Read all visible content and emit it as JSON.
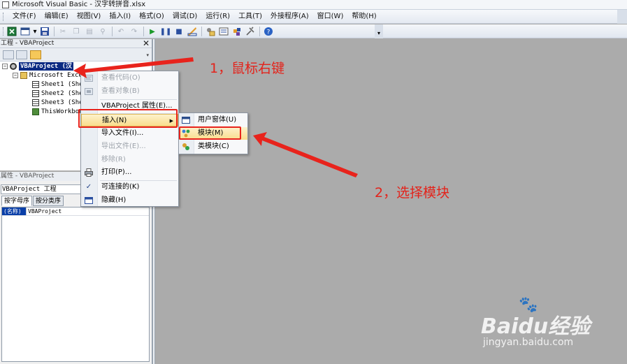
{
  "window": {
    "title": "Microsoft Visual Basic - 汉字转拼音.xlsx"
  },
  "menubar": {
    "items": [
      "文件(F)",
      "编辑(E)",
      "视图(V)",
      "插入(I)",
      "格式(O)",
      "调试(D)",
      "运行(R)",
      "工具(T)",
      "外接程序(A)",
      "窗口(W)",
      "帮助(H)"
    ]
  },
  "toolbar": {
    "icons": [
      "excel-icon",
      "insert-userform-icon",
      "dropdown-icon",
      "save-icon",
      "cut-icon",
      "copy-icon",
      "paste-icon",
      "find-icon",
      "undo-icon",
      "redo-icon",
      "run-icon",
      "break-icon",
      "reset-icon",
      "design-mode-icon",
      "project-explorer-icon",
      "properties-window-icon",
      "object-browser-icon",
      "toolbox-icon",
      "help-icon"
    ]
  },
  "project_pane": {
    "title": "工程 - VBAProject",
    "close": "✕",
    "tree": {
      "root": "VBAProject (汉",
      "folder": "Microsoft Excel",
      "sheets": [
        "Sheet1 (She",
        "Sheet2 (She",
        "Sheet3 (She"
      ],
      "workbook": "ThisWorkbook"
    }
  },
  "props_pane": {
    "title": "属性 - VBAProject",
    "object": "VBAProject 工程",
    "tabs": [
      "按字母序",
      "按分类序"
    ],
    "rows": [
      {
        "name": "(名称)",
        "value": "VBAProject"
      }
    ]
  },
  "context_menu": {
    "view_code": "查看代码(O)",
    "view_object": "查看对象(B)",
    "project_props": "VBAProject 属性(E)...",
    "insert": "插入(N)",
    "import": "导入文件(I)...",
    "export": "导出文件(E)...",
    "remove": "移除(R)",
    "print": "打印(P)...",
    "dockable": "可连接的(K)",
    "hide": "隐藏(H)"
  },
  "submenu": {
    "userform": "用户窗体(U)",
    "module": "模块(M)",
    "class_module": "类模块(C)"
  },
  "annotations": {
    "step1": "1，鼠标右键",
    "step2": "2，选择模块",
    "color": "#e3231b"
  },
  "watermark": {
    "brand": "Baidu经验",
    "url": "jingyan.baidu.com"
  }
}
